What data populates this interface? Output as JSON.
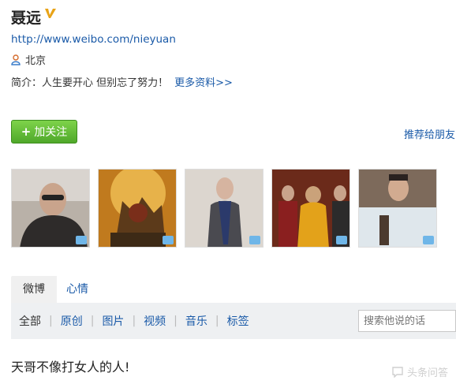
{
  "profile": {
    "name": "聂远",
    "url": "http://www.weibo.com/nieyuan",
    "location": "北京",
    "bio_prefix": "简介：人生要开心 但别忘了努力！",
    "bio_more": "更多资料>>"
  },
  "actions": {
    "follow_label": "加关注",
    "recommend_label": "推荐给朋友"
  },
  "tabs": [
    {
      "label": "微博"
    },
    {
      "label": "心情"
    }
  ],
  "filters": [
    {
      "label": "全部"
    },
    {
      "label": "原创"
    },
    {
      "label": "图片"
    },
    {
      "label": "视频"
    },
    {
      "label": "音乐"
    },
    {
      "label": "标签"
    }
  ],
  "search": {
    "placeholder": "搜索他说的话"
  },
  "post": {
    "text": "天哥不像打女人的人!"
  },
  "watermark": {
    "text": "头条问答"
  },
  "colors": {
    "link": "#1a5aa8",
    "follow_green": "#5cb82f",
    "verified": "#e8a317"
  }
}
